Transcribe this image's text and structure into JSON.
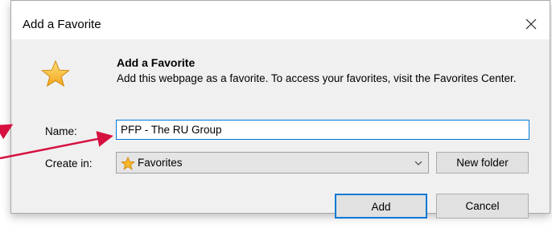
{
  "dialog": {
    "title": "Add a Favorite",
    "header_title": "Add a Favorite",
    "header_desc": "Add this webpage as a favorite. To access your favorites, visit the Favorites Center.",
    "name_label": "Name:",
    "name_value": "PFP - The RU Group",
    "create_in_label": "Create in:",
    "create_in_value": "Favorites",
    "new_folder_label": "New folder",
    "add_label": "Add",
    "cancel_label": "Cancel"
  },
  "icons": {
    "close": "close-icon",
    "favorite_star": "star-icon",
    "dropdown": "chevron-down-icon"
  },
  "colors": {
    "accent": "#0078d7",
    "annotation_arrow": "#d6103f",
    "star": "#f7b928"
  }
}
